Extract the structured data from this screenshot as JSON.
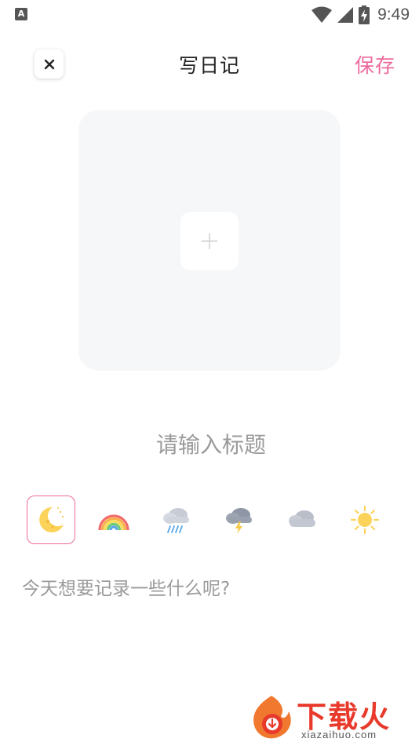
{
  "status_bar": {
    "app_icon_letter": "A",
    "time": "9:49"
  },
  "header": {
    "close_icon": "close-icon",
    "title": "写日记",
    "save_label": "保存",
    "accent_color": "#ee6a9e"
  },
  "photo": {
    "add_icon": "plus-icon"
  },
  "title_input": {
    "placeholder": "请输入标题",
    "value": ""
  },
  "weather": {
    "selected": "moon",
    "options": [
      "moon-icon",
      "rainbow-icon",
      "rain-icon",
      "thunderstorm-icon",
      "cloudy-icon",
      "sunny-icon"
    ]
  },
  "content_input": {
    "placeholder": "今天想要记录一些什么呢?",
    "value": ""
  },
  "watermark": {
    "brand": "下载火",
    "domain": "xiazaihuo.com"
  }
}
